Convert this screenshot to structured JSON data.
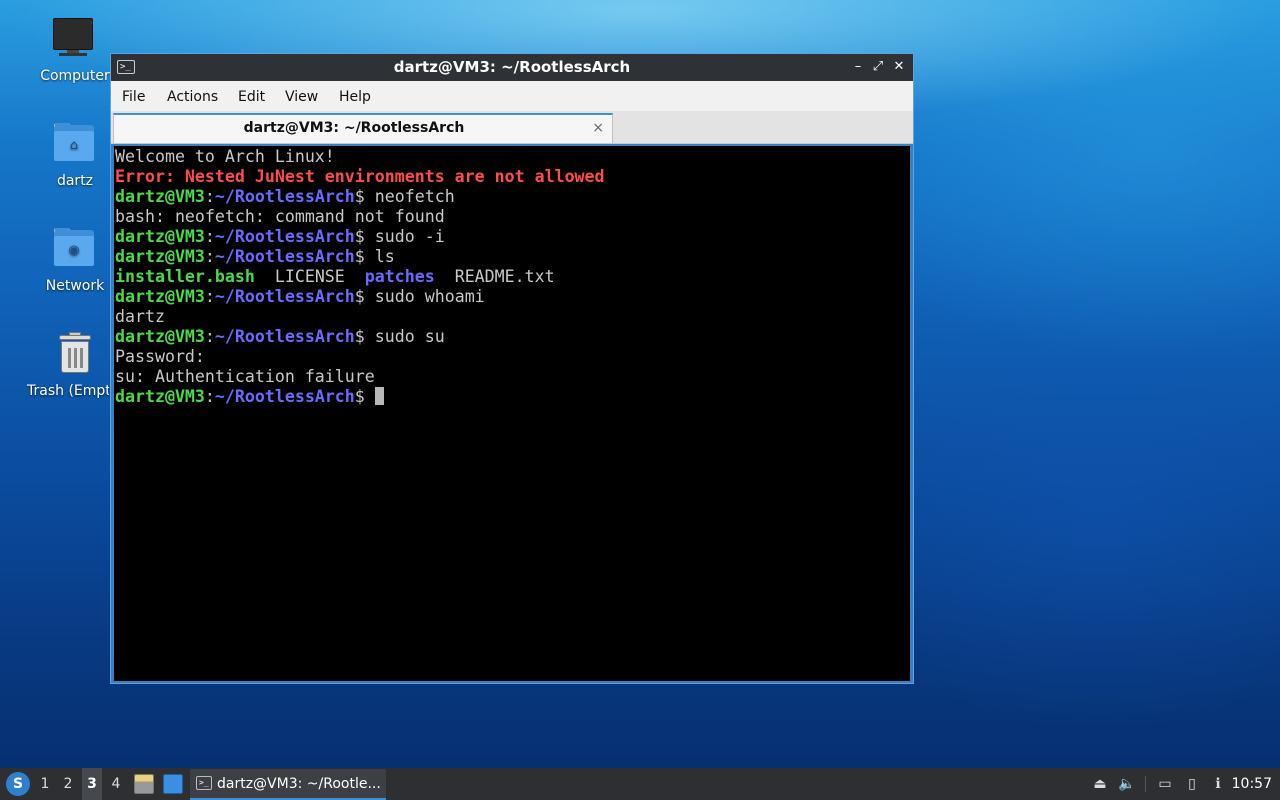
{
  "desktop": {
    "icons": [
      {
        "label": "Computer"
      },
      {
        "label": "dartz"
      },
      {
        "label": "Network"
      },
      {
        "label": "Trash (Empty)"
      }
    ]
  },
  "window": {
    "title": "dartz@VM3: ~/RootlessArch",
    "icon_text": ">_",
    "controls": {
      "minimize": "–",
      "maximize": "⤢",
      "close": "✕"
    },
    "menu": [
      "File",
      "Actions",
      "Edit",
      "View",
      "Help"
    ],
    "tab": {
      "label": "dartz@VM3: ~/RootlessArch",
      "close": "×"
    }
  },
  "terminal": {
    "prompt_user": "dartz@VM3",
    "prompt_sep": ":",
    "prompt_path": "~/RootlessArch",
    "prompt_end": "$ ",
    "welcome": "Welcome to Arch Linux!",
    "error": "Error: Nested JuNest environments are not allowed",
    "cmd1": "neofetch",
    "out1": "bash: neofetch: command not found",
    "cmd2": "sudo -i",
    "cmd3": "ls",
    "ls_files": [
      "installer.bash",
      "LICENSE",
      "patches",
      "README.txt"
    ],
    "cmd4": "sudo whoami",
    "out4": "dartz",
    "cmd5": "sudo su",
    "out5a": "Password:",
    "out5b": "su: Authentication failure"
  },
  "taskbar": {
    "workspaces": [
      "1",
      "2",
      "3",
      "4"
    ],
    "active_workspace": "3",
    "task_label": "dartz@VM3: ~/Rootle...",
    "clock": "10:57"
  },
  "colors": {
    "accent": "#3d8fd6",
    "terminal_bg": "#000000",
    "prompt_user": "#4cd94c",
    "prompt_path": "#6a6aff",
    "error": "#ff4c4c"
  }
}
